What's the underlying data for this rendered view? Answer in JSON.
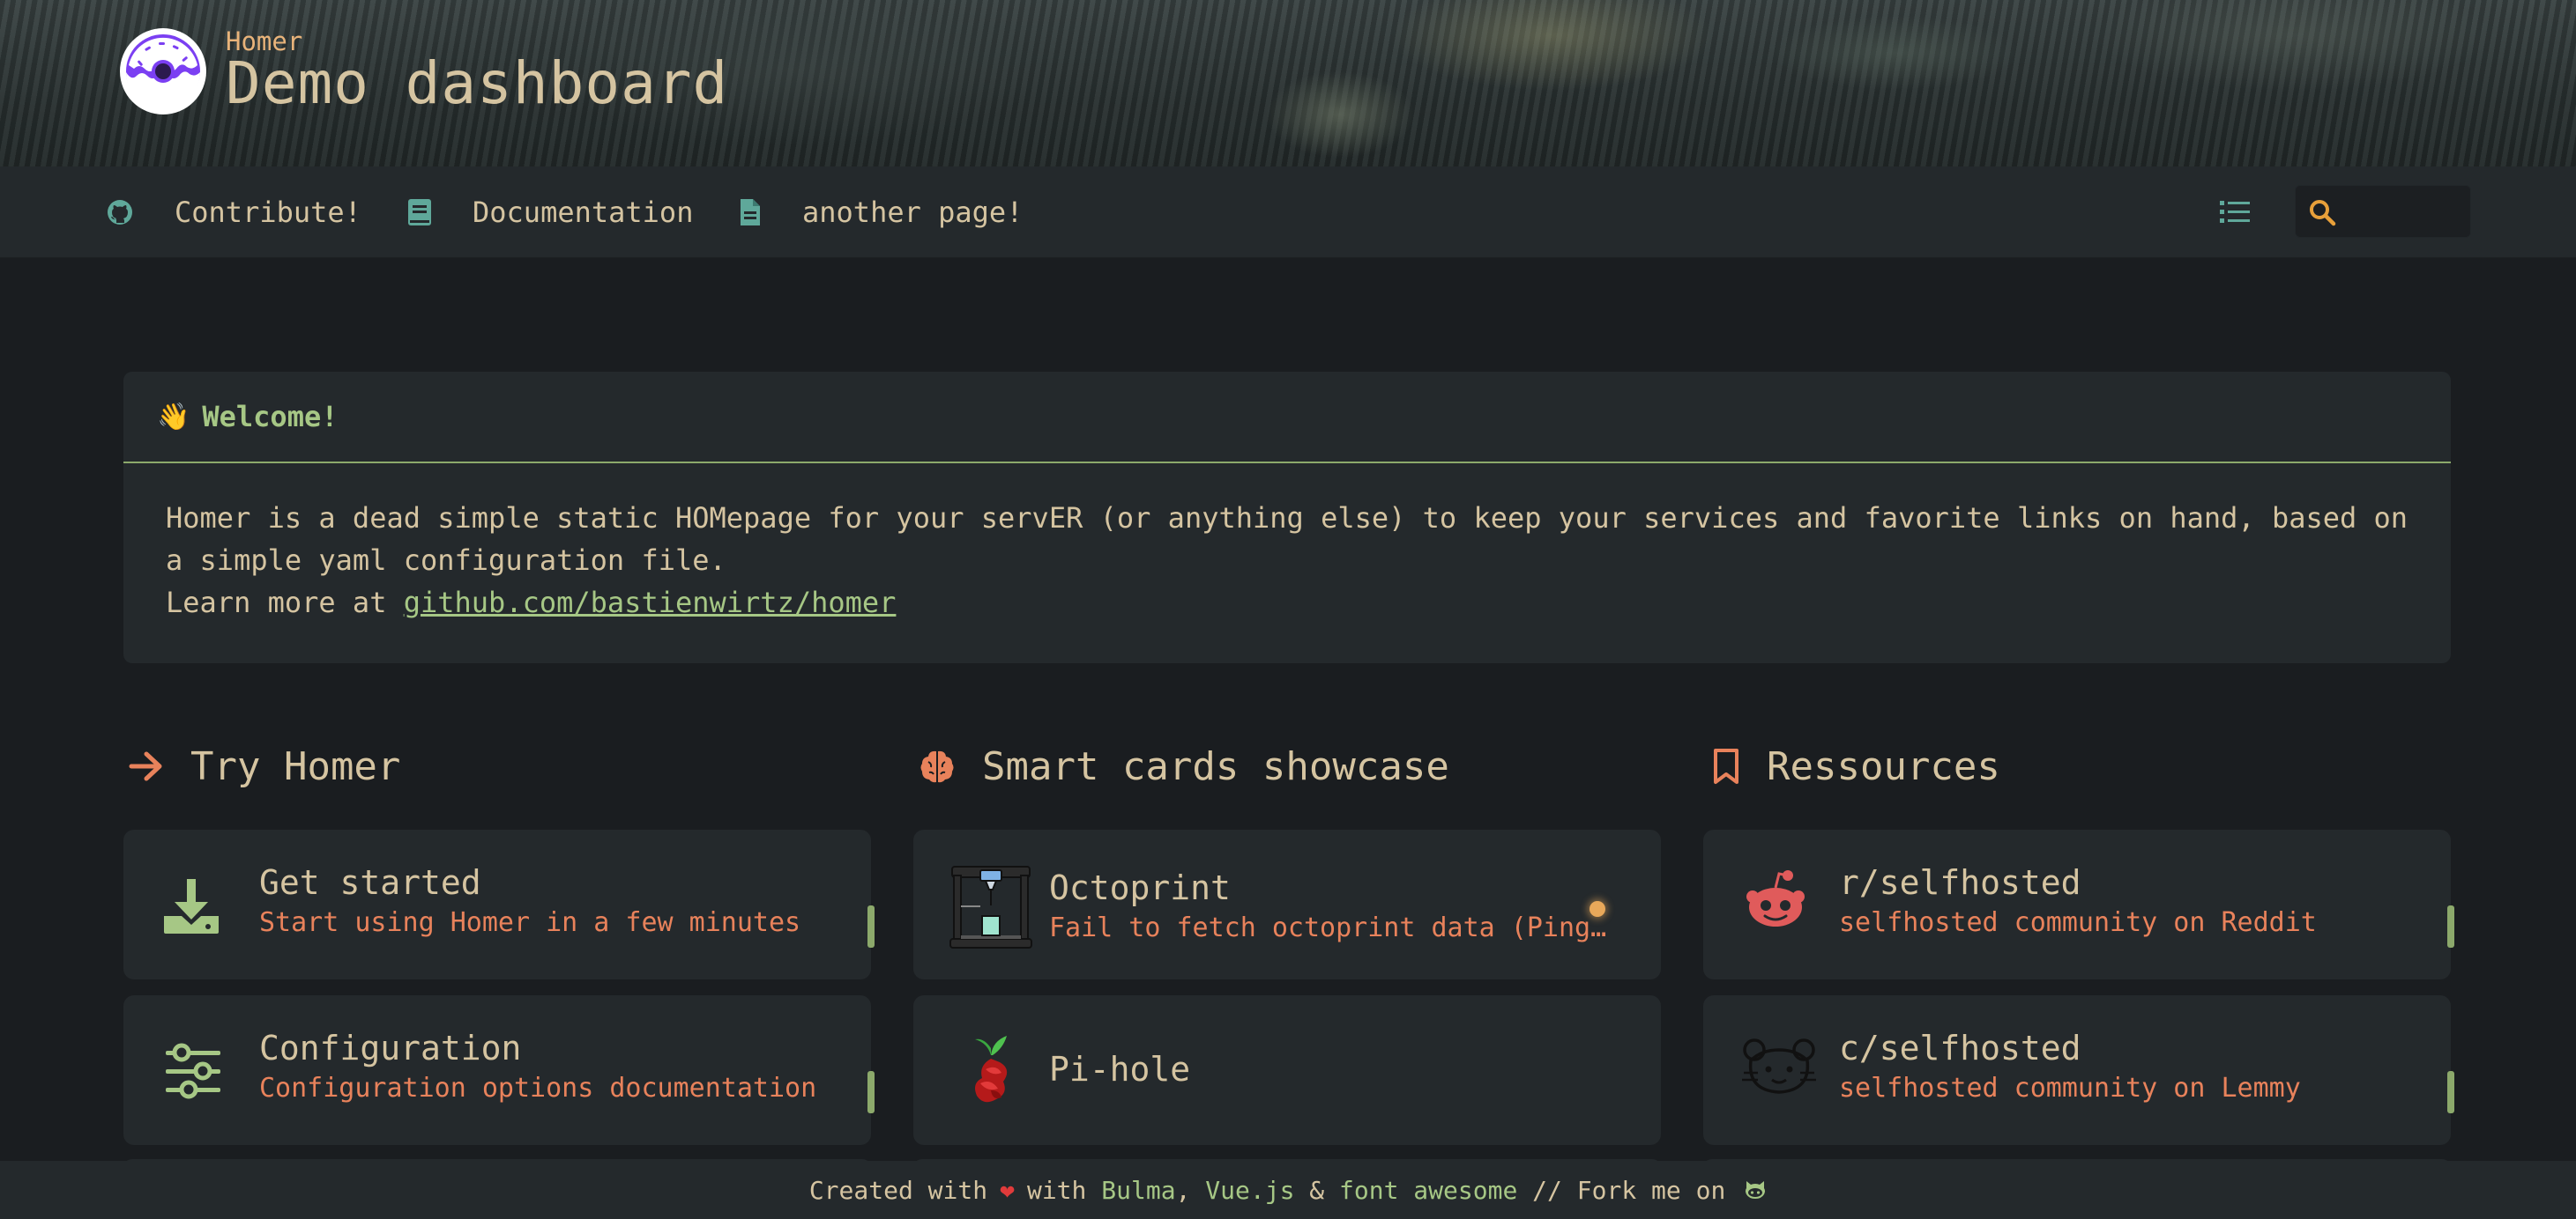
{
  "header": {
    "subtitle": "Homer",
    "title": "Demo dashboard"
  },
  "navbar": {
    "links": [
      {
        "label": "Contribute!",
        "icon": "github-icon"
      },
      {
        "label": "Documentation",
        "icon": "book-icon"
      },
      {
        "label": "another page!",
        "icon": "file-icon"
      }
    ],
    "search_value": ""
  },
  "message": {
    "title": "Welcome!",
    "body_line1": "Homer is a dead simple static HOMepage for your servER (or anything else) to keep your services and favorite links on hand, based on",
    "body_line2": "a simple yaml configuration file.",
    "body_prefix": "Learn more at ",
    "link": "github.com/bastienwirtz/homer"
  },
  "columns": [
    {
      "title": "Try Homer",
      "icon": "arrow-right-icon",
      "cards": [
        {
          "title": "Get started",
          "subtitle": "Start using Homer in a few minutes",
          "icon": "download-icon"
        },
        {
          "title": "Configuration",
          "subtitle": "Configuration options documentation",
          "icon": "sliders-icon"
        }
      ]
    },
    {
      "title": "Smart cards showcase",
      "icon": "brain-icon",
      "cards": [
        {
          "title": "Octoprint",
          "subtitle": "Fail to fetch octoprint data (Ping…",
          "icon": "3d-printer-icon"
        },
        {
          "title": "Pi-hole",
          "subtitle": "",
          "icon": "pihole-icon"
        }
      ]
    },
    {
      "title": "Ressources",
      "icon": "bookmark-icon",
      "cards": [
        {
          "title": "r/selfhosted",
          "subtitle": "selfhosted community on Reddit",
          "icon": "reddit-icon"
        },
        {
          "title": "c/selfhosted",
          "subtitle": "selfhosted community on Lemmy",
          "icon": "lemmy-icon"
        }
      ]
    }
  ],
  "footer": {
    "created": "Created with",
    "with": "with",
    "bulma": "Bulma",
    "comma": ",",
    "vue": "Vue.js",
    "amp": "&",
    "fa": "font awesome",
    "fork": "// Fork me on"
  },
  "colors": {
    "accent_green": "#a6c785",
    "accent_orange": "#e8825b",
    "text": "#d5c4a1",
    "card_bg": "#24292c",
    "page_bg": "#1a1d20"
  }
}
